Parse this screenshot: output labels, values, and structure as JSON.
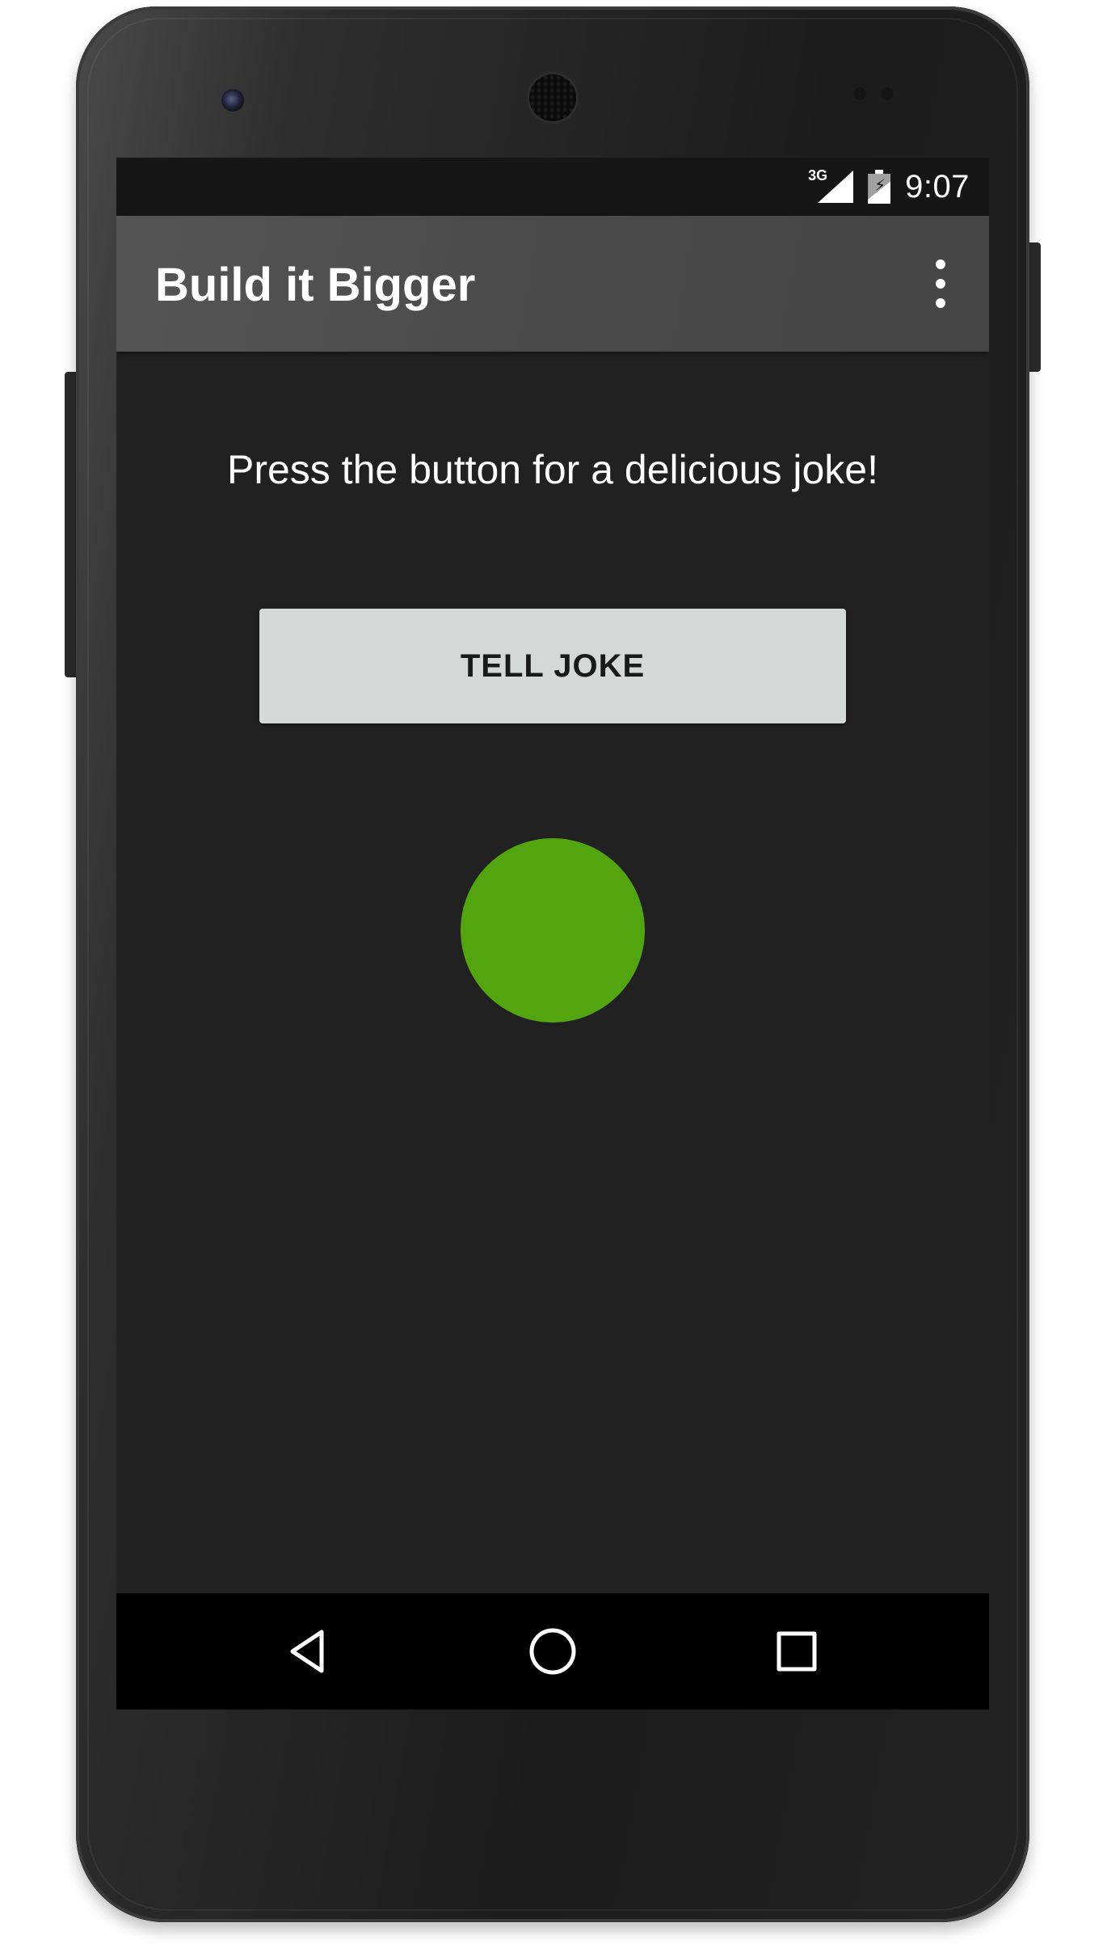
{
  "status_bar": {
    "network_label": "3G",
    "time": "9:07",
    "icons": [
      "signal-icon",
      "battery-charging-icon"
    ]
  },
  "app_bar": {
    "title": "Build it Bigger",
    "menu_icon": "overflow-menu-icon"
  },
  "main": {
    "prompt": "Press the button for a delicious joke!",
    "button_label": "TELL JOKE",
    "indicator_color": "#52a50f"
  },
  "nav_bar": {
    "icons": [
      "back-icon",
      "home-icon",
      "recents-icon"
    ]
  },
  "colors": {
    "screen_background": "#212121",
    "app_bar": "#4a4a4a",
    "button_background": "#d6d7d7",
    "accent_green": "#52a50f"
  }
}
